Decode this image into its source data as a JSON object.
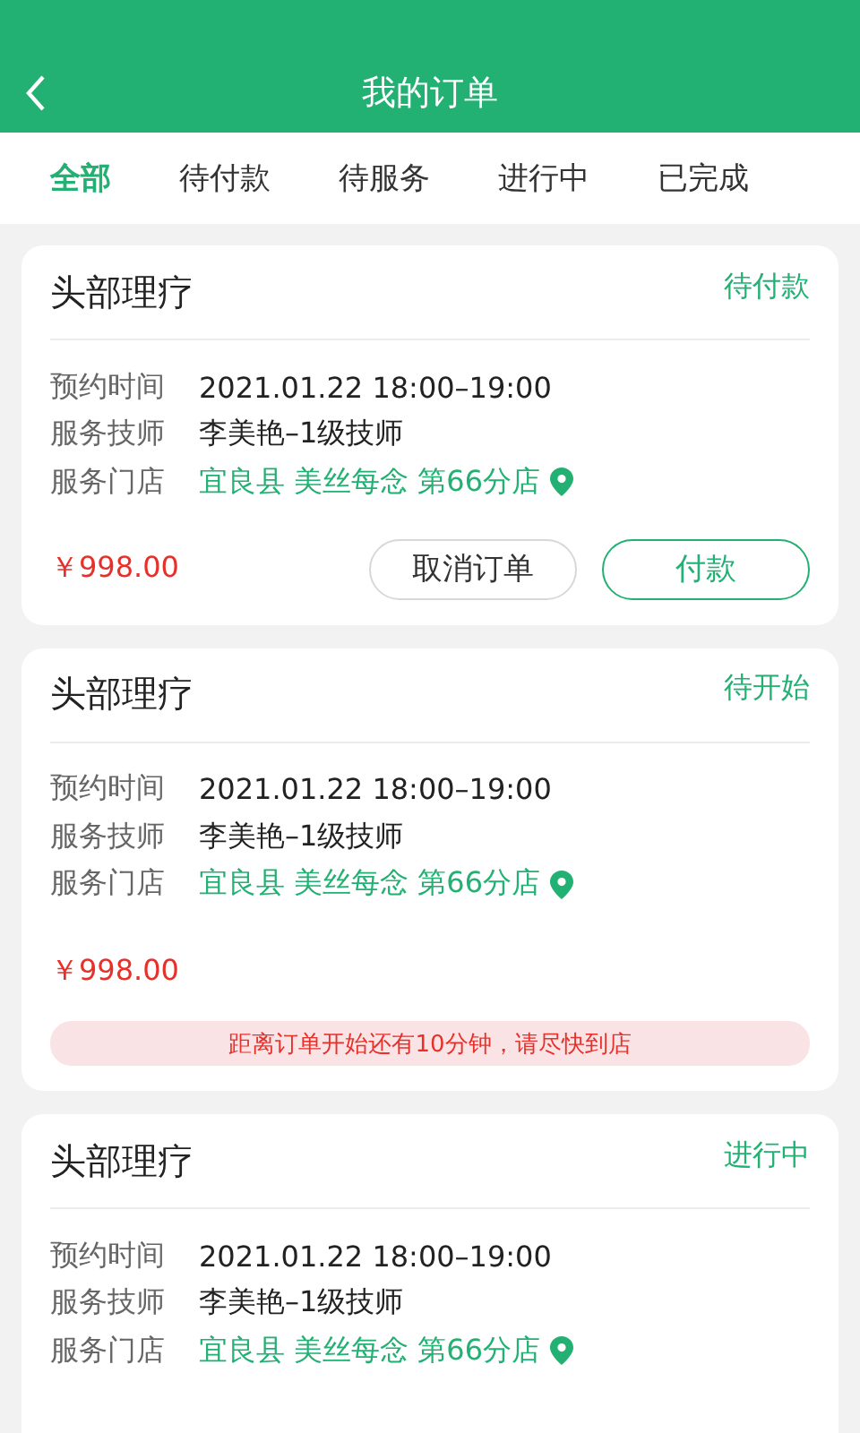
{
  "header": {
    "title": "我的订单"
  },
  "tabs": [
    {
      "label": "全部",
      "selected": true
    },
    {
      "label": "待付款",
      "selected": false
    },
    {
      "label": "待服务",
      "selected": false
    },
    {
      "label": "进行中",
      "selected": false
    },
    {
      "label": "已完成",
      "selected": false
    }
  ],
  "orders": [
    {
      "title": "头部理疗",
      "status": "待付款",
      "fields": [
        {
          "label": "预约时间",
          "value": "2021.01.22 18:00–19:00",
          "kind": "text"
        },
        {
          "label": "服务技师",
          "value": "李美艳–1级技师",
          "kind": "text"
        },
        {
          "label": "服务门店",
          "value": "宜良县 美丝每念 第66分店",
          "kind": "location"
        }
      ],
      "price": "￥998.00",
      "actions": [
        {
          "label": "取消订单",
          "kind": "secondary"
        },
        {
          "label": "付款",
          "kind": "primary"
        }
      ]
    },
    {
      "title": "头部理疗",
      "status": "待开始",
      "fields": [
        {
          "label": "预约时间",
          "value": "2021.01.22 18:00–19:00",
          "kind": "text"
        },
        {
          "label": "服务技师",
          "value": "李美艳–1级技师",
          "kind": "text"
        },
        {
          "label": "服务门店",
          "value": "宜良县 美丝每念 第66分店",
          "kind": "location"
        }
      ],
      "price": "￥998.00",
      "notice": "距离订单开始还有10分钟，请尽快到店"
    },
    {
      "title": "头部理疗",
      "status": "进行中",
      "fields": [
        {
          "label": "预约时间",
          "value": "2021.01.22 18:00–19:00",
          "kind": "text"
        },
        {
          "label": "服务技师",
          "value": "李美艳–1级技师",
          "kind": "text"
        },
        {
          "label": "服务门店",
          "value": "宜良县 美丝每念 第66分店",
          "kind": "location"
        }
      ]
    }
  ]
}
